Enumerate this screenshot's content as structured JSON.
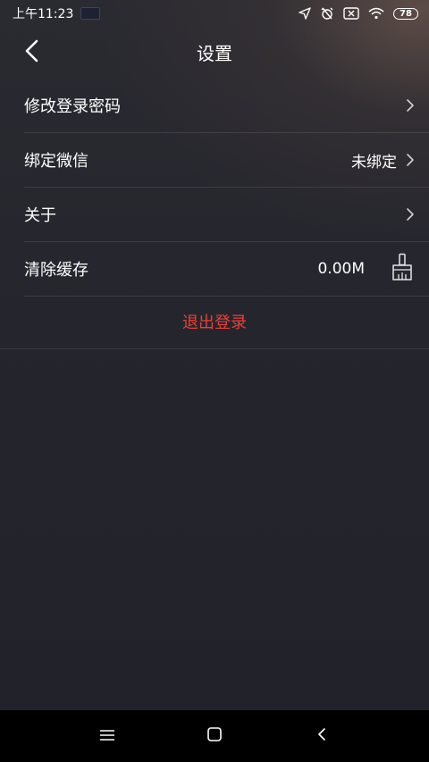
{
  "status_bar": {
    "time": "上午11:23",
    "battery": "78"
  },
  "header": {
    "title": "设置"
  },
  "settings": {
    "items": [
      {
        "label": "修改登录密码",
        "value": ""
      },
      {
        "label": "绑定微信",
        "value": "未绑定"
      },
      {
        "label": "关于",
        "value": ""
      },
      {
        "label": "清除缓存",
        "value": "0.00M"
      }
    ],
    "logout_label": "退出登录"
  },
  "icons": {
    "back": "back-arrow-icon",
    "chevron": "chevron-right-icon",
    "clear_cache": "broom-icon",
    "nav_menu": "menu-icon",
    "nav_home": "home-icon",
    "nav_back": "nav-back-icon"
  },
  "colors": {
    "accent_red": "#e8413a",
    "background": "#23232b"
  }
}
